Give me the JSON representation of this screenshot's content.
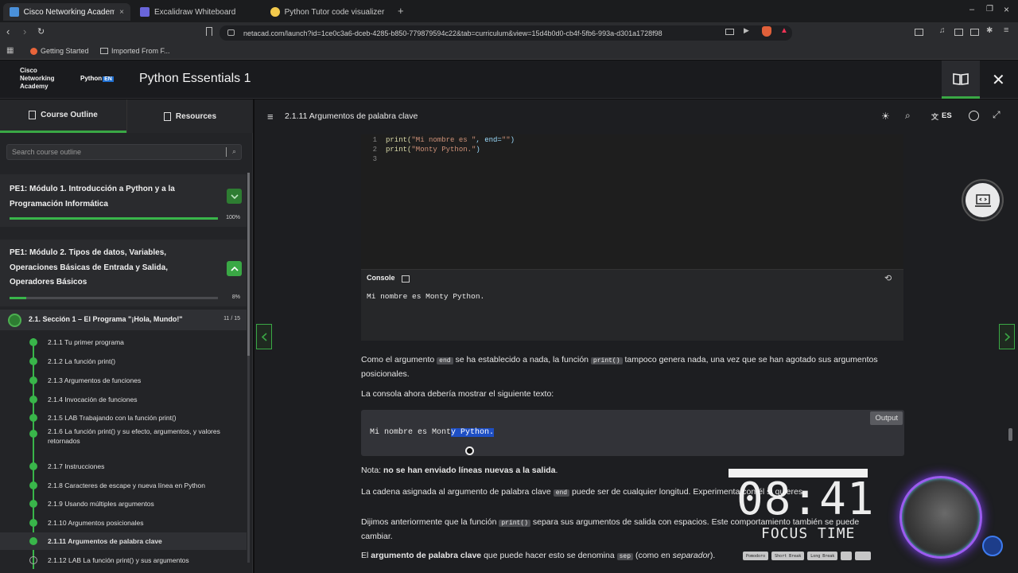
{
  "browser": {
    "tabs": [
      {
        "label": "Cisco Networking Academy: P",
        "active": true
      },
      {
        "label": "Excalidraw Whiteboard",
        "active": false
      },
      {
        "label": "Python Tutor code visualizer: Visu",
        "active": false
      }
    ],
    "url": "netacad.com/launch?id=1ce0c3a6-dceb-4285-b850-779879594c22&tab=curriculum&view=15d4b0d0-cb4f-5fb6-993a-d301a1728f98",
    "bookmarks": [
      "Getting Started",
      "Imported From F..."
    ]
  },
  "app": {
    "brand": "Cisco Networking Academy",
    "brand_lines": [
      "Cisco",
      "Networking",
      "Academy"
    ],
    "python_badge": "Python",
    "python_badge_tag": "EN",
    "title": "Python Essentials 1"
  },
  "sidebar": {
    "tabs": [
      "Course Outline",
      "Resources"
    ],
    "search_placeholder": "Search course outline",
    "modules": [
      {
        "title": "PE1: Módulo 1. Introducción a Python y a la Programación Informática",
        "progress": "100%",
        "progress_value": 100
      },
      {
        "title": "PE1: Módulo 2. Tipos de datos, Variables, Operaciones Básicas de Entrada y Salida, Operadores Básicos",
        "progress": "8%",
        "progress_value": 8
      }
    ],
    "section": {
      "title": "2.1. Sección 1 – El Programa \"¡Hola, Mundo!\"",
      "count": "11 / 15"
    },
    "lessons": [
      "2.1.1 Tu primer programa",
      "2.1.2 La función print()",
      "2.1.3 Argumentos de funciones",
      "2.1.4 Invocación de funciones",
      "2.1.5 LAB Trabajando con la función print()",
      "2.1.6 La función print() y su efecto, argumentos, y valores retornados",
      "2.1.7 Instrucciones",
      "2.1.8 Caracteres de escape y nueva línea en Python",
      "2.1.9 Usando múltiples argumentos",
      "2.1.10 Argumentos posicionales",
      "2.1.11 Argumentos de palabra clave",
      "2.1.12 LAB La función print() y sus argumentos"
    ],
    "active_lesson": 10
  },
  "main": {
    "lesson_title": "2.1.11 Argumentos de palabra clave",
    "language": "ES",
    "code_lines": [
      {
        "n": "1",
        "pre": "print(",
        "str": "\"Mi nombre es \"",
        "post": ", end=",
        "str2": "\"\"",
        "end": ")"
      },
      {
        "n": "2",
        "pre": "print(",
        "str": "\"Monty Python.\"",
        "post": ")",
        "str2": "",
        "end": ""
      },
      {
        "n": "3",
        "pre": "",
        "str": "",
        "post": "",
        "str2": "",
        "end": ""
      }
    ],
    "console_label": "Console",
    "console_output": "Mi nombre es Monty Python.",
    "p1": {
      "a": "Como el argumento ",
      "code1": "end",
      "b": " se ha establecido a nada, la función ",
      "code2": "print()",
      "c": " tampoco genera nada, una vez que se han agotado sus argumentos posicionales."
    },
    "p2": "La consola ahora debería mostrar el siguiente texto:",
    "output_label": "Output",
    "output_plain": "Mi nombre es Mont",
    "output_selected": "y Python. ",
    "note": {
      "a": "Nota: ",
      "b": "no se han enviado líneas nuevas a la salida",
      "c": "."
    },
    "p3": {
      "a": "La cadena asignada al argumento de palabra clave ",
      "code": "end",
      "b": " puede ser de cualquier longitud. Experimenta con él si quieres."
    },
    "p4": {
      "a": "Dijimos anteriormente que la función ",
      "code": "print()",
      "b": " separa sus argumentos de salida con espacios. Este comportamiento también se puede cambiar."
    },
    "p5": {
      "a": "El ",
      "b": "argumento de palabra clave",
      "c": " que puede hacer esto se denomina ",
      "code": "sep",
      "d": " (como en ",
      "e": "separador",
      "f": ")."
    }
  },
  "overlay": {
    "timer": "08:41",
    "label": "FOCUS TIME",
    "pills": [
      "Pomodoro",
      "Short Break",
      "Long Break"
    ]
  }
}
